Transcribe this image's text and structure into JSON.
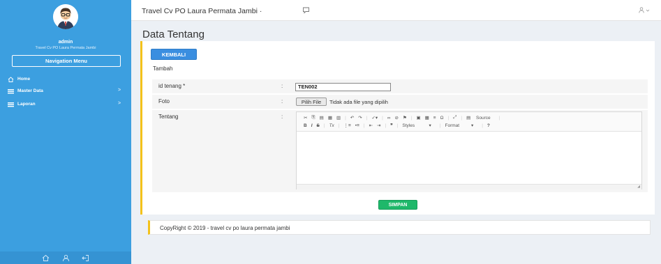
{
  "sidebar": {
    "user_name": "admin",
    "user_subtitle": "Travel Cv PO Laura Permata Jambi",
    "nav_header": "Navigation Menu",
    "items": [
      {
        "label": "Home",
        "icon": "home-icon",
        "has_chevron": false
      },
      {
        "label": "Master Data",
        "icon": "list-icon",
        "has_chevron": true
      },
      {
        "label": "Laporan",
        "icon": "list-icon",
        "has_chevron": true
      }
    ],
    "chevron": ">",
    "footer_icons": [
      "home-icon",
      "user-icon",
      "logout-icon"
    ]
  },
  "header": {
    "title": "Travel Cv PO Laura Permata Jambi ·",
    "chat_icon": "chat-icon",
    "user_icon": "user-icon"
  },
  "page": {
    "title": "Data Tentang",
    "back_button": "KEMBALI",
    "sub_title": "Tambah"
  },
  "form": {
    "id_label": "id tenang *",
    "id_value": "TEN002",
    "foto_label": "Foto",
    "file_button": "Pilih File",
    "file_status": "Tidak ada file yang dipilih",
    "tentang_label": "Tentang",
    "colon": ":",
    "toolbar_row1_source": "Source",
    "toolbar_row2_styles": "Styles",
    "toolbar_row2_format": "Format",
    "save_button": "SIMPAN"
  },
  "footer": {
    "text": "CopyRight © 2019 - travel cv po laura permata jambi"
  },
  "colors": {
    "sidebar": "#3c9fe0",
    "accent_yellow": "#f3c21b",
    "primary_button": "#3a8ee0",
    "save_button": "#1fb86a"
  }
}
